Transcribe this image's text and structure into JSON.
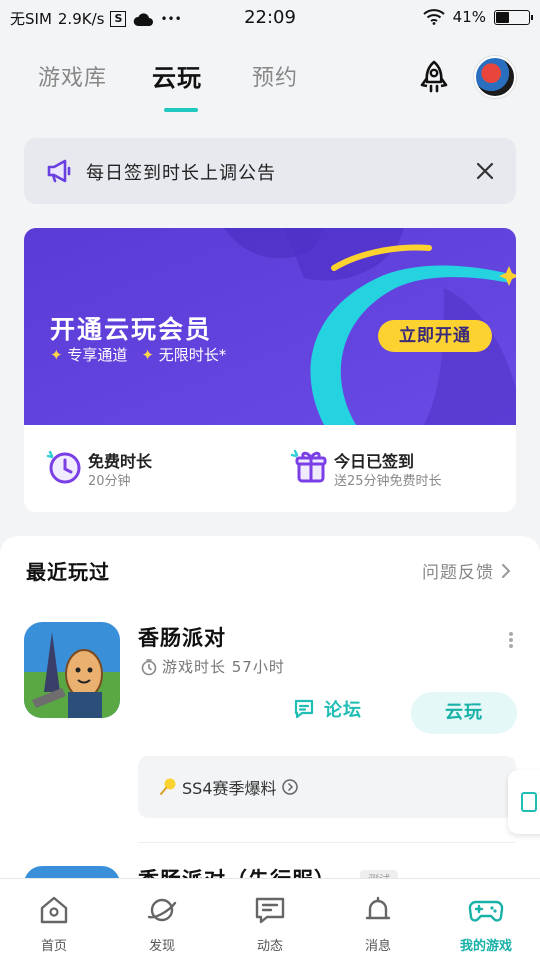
{
  "status_bar": {
    "carrier": "无SIM",
    "speed": "2.9K/s",
    "sim_badge": "S",
    "more": "•••",
    "time": "22:09",
    "battery": "41%",
    "battery_level": 0.41
  },
  "tabs": [
    {
      "label": "游戏库",
      "active": false
    },
    {
      "label": "云玩",
      "active": true
    },
    {
      "label": "预约",
      "active": false
    }
  ],
  "notice": {
    "text": "每日签到时长上调公告",
    "icon": "megaphone-icon"
  },
  "vip": {
    "title": "开通云玩会员",
    "perks": [
      "专享通道",
      "无限时长*"
    ],
    "button": "立即开通",
    "info": [
      {
        "title": "免费时长",
        "sub": "20分钟",
        "icon": "clock-icon"
      },
      {
        "title": "今日已签到",
        "sub": "送25分钟免费时长",
        "icon": "gift-icon"
      }
    ],
    "colors": {
      "banner": "#5b3fd9",
      "accent": "#fcd230",
      "streak": "#25d3e0"
    }
  },
  "recent": {
    "title": "最近玩过",
    "feedback": "问题反馈",
    "games": [
      {
        "name": "香肠派对",
        "play_time": "游戏时长 57小时",
        "forum": "论坛",
        "cloud_play": "云玩",
        "news": "SS4赛季爆料"
      },
      {
        "name": "香肠派对（先行服）",
        "badge": "测试"
      }
    ]
  },
  "bottom_nav": [
    {
      "label": "首页",
      "icon": "home-icon",
      "active": false
    },
    {
      "label": "发现",
      "icon": "planet-icon",
      "active": false
    },
    {
      "label": "动态",
      "icon": "chat-icon",
      "active": false
    },
    {
      "label": "消息",
      "icon": "bell-icon",
      "active": false
    },
    {
      "label": "我的游戏",
      "icon": "gamepad-icon",
      "active": true
    }
  ],
  "accent_color": "#20c9c0"
}
